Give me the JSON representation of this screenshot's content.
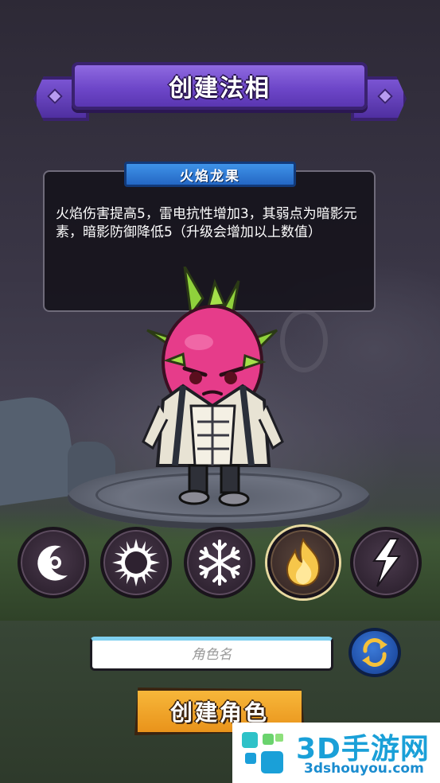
{
  "header": {
    "title": "创建法相"
  },
  "description": {
    "tab_title": "火焰龙果",
    "text": "火焰伤害提高5，雷电抗性增加3，其弱点为暗影元素，暗影防御降低5（升级会增加以上数值）"
  },
  "elements": [
    {
      "name": "moon",
      "icon": "crescent-moon-icon",
      "selected": false
    },
    {
      "name": "dark-sun",
      "icon": "black-sun-icon",
      "selected": false
    },
    {
      "name": "ice",
      "icon": "snowflake-icon",
      "selected": false
    },
    {
      "name": "fire",
      "icon": "flame-icon",
      "selected": true
    },
    {
      "name": "thunder",
      "icon": "lightning-icon",
      "selected": false
    }
  ],
  "name_input": {
    "placeholder": "角色名",
    "value": ""
  },
  "create_button": {
    "label": "创建角色"
  },
  "watermark": {
    "title": "3D手游网",
    "url": "3dshouyou.com"
  },
  "colors": {
    "banner_purple": "#6e47c9",
    "tab_blue": "#2467c4",
    "button_orange": "#f0a52a",
    "selected_ring": "#e8d9a0",
    "watermark_blue": "#1aa0d8"
  }
}
